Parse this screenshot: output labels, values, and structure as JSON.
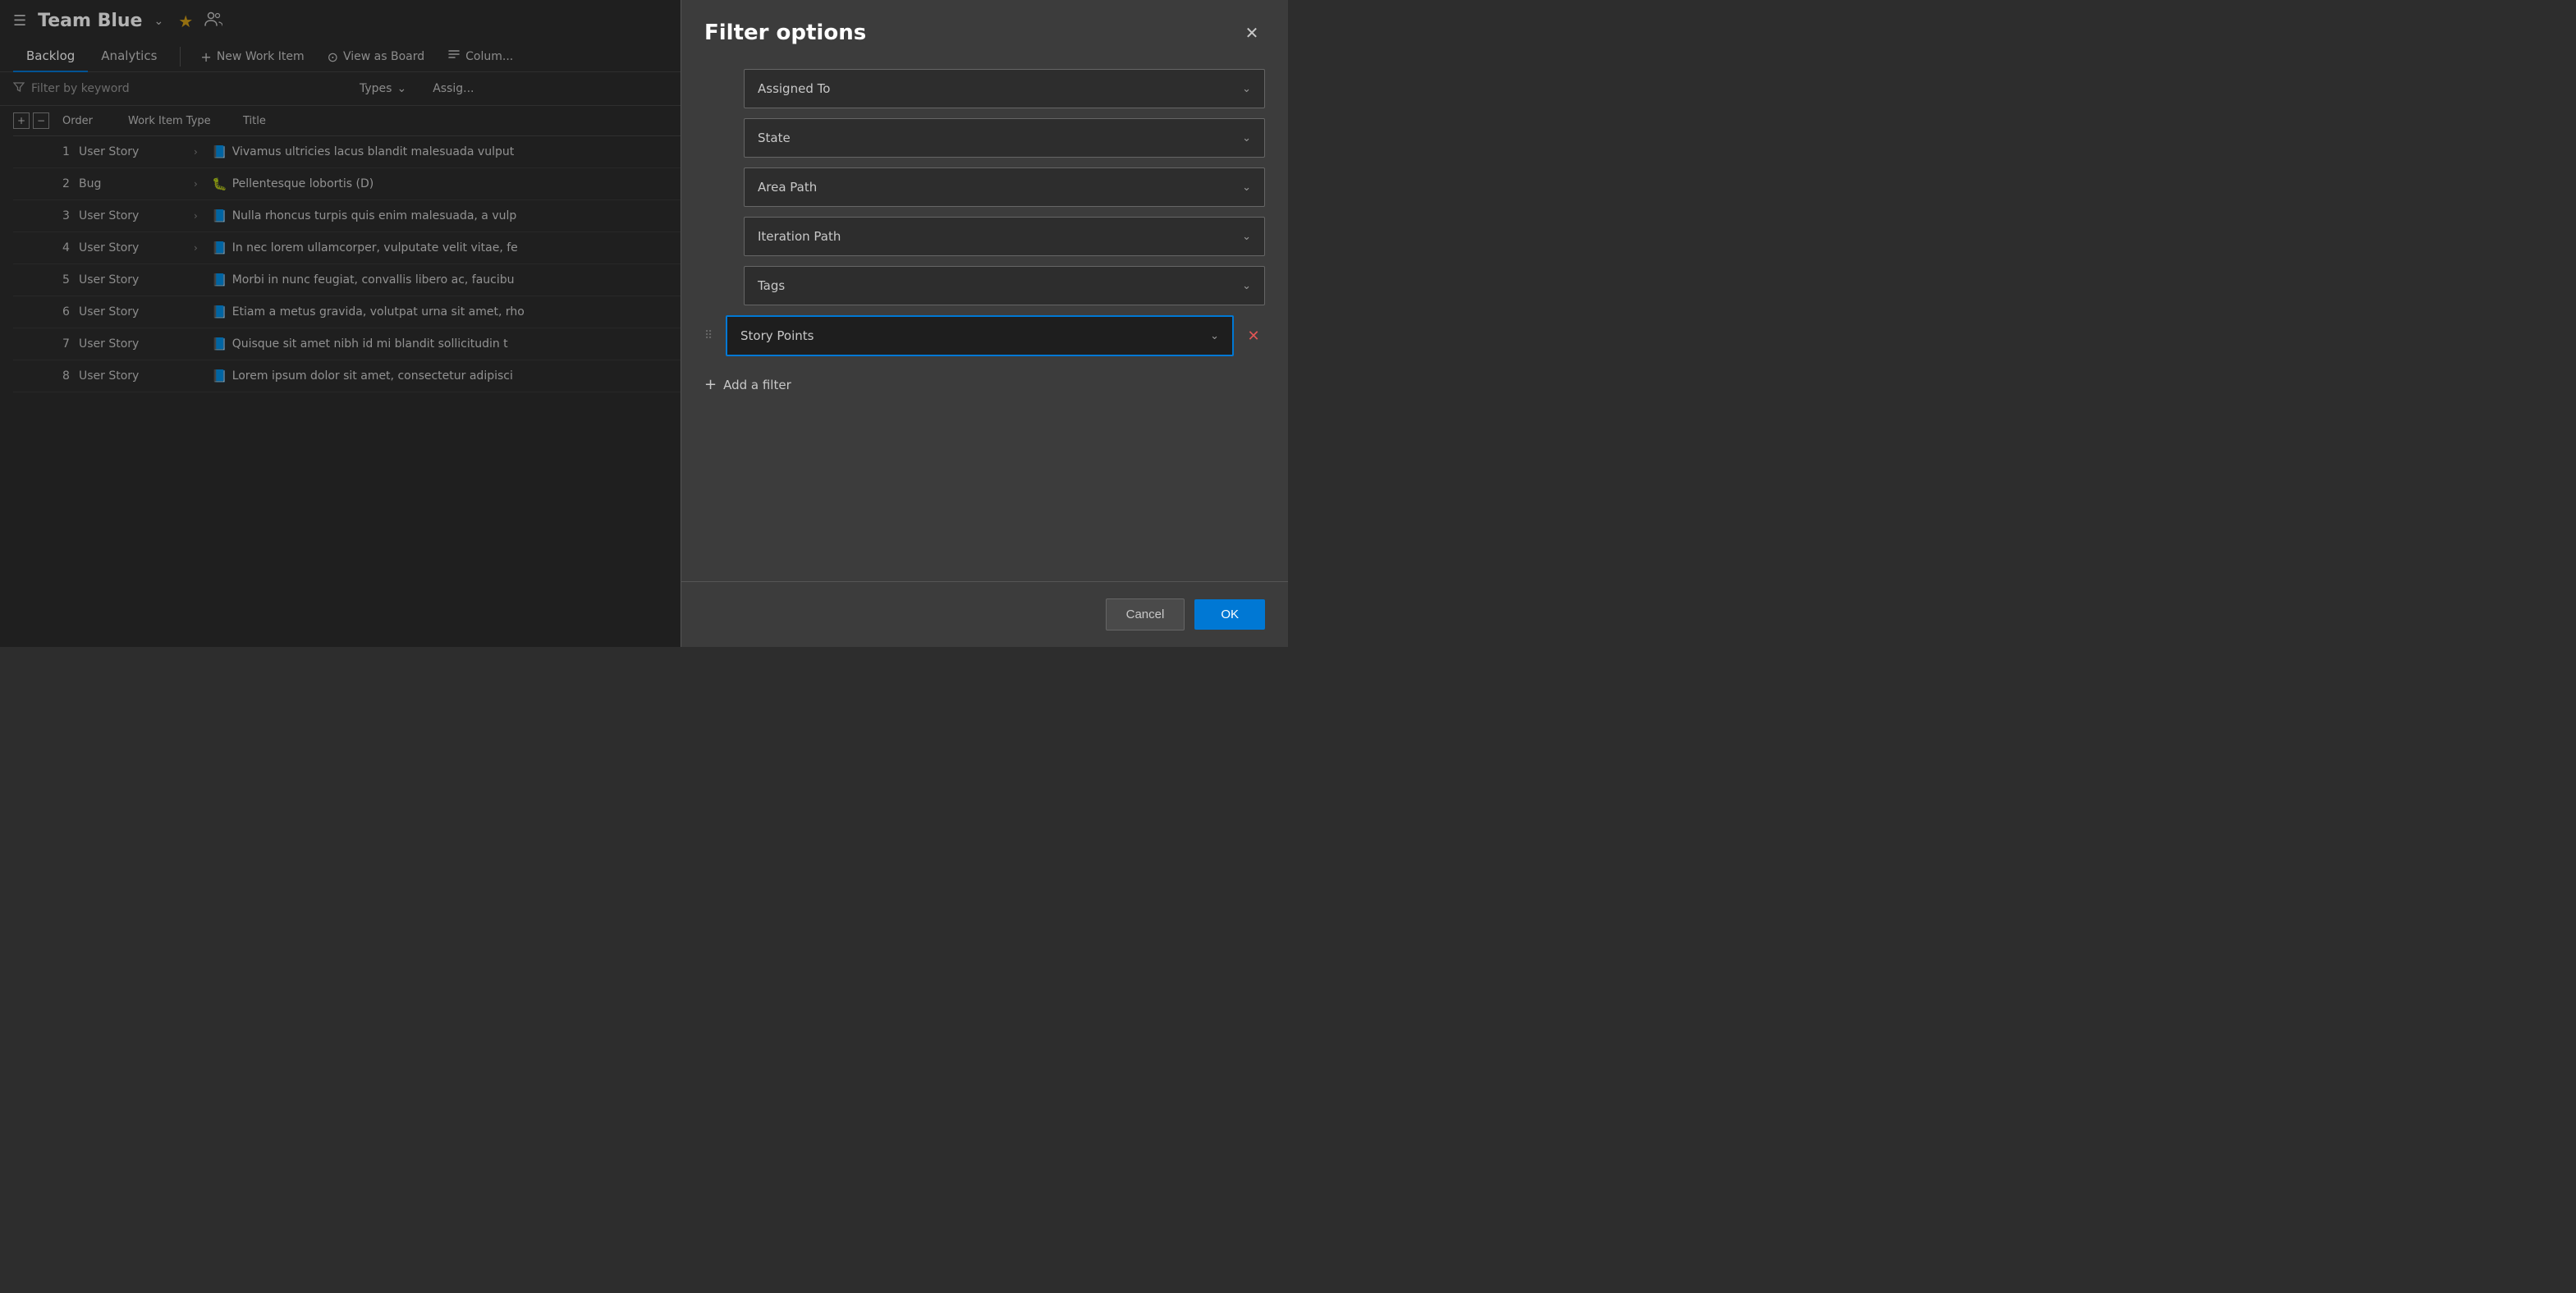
{
  "header": {
    "hamburger": "☰",
    "team_name": "Team Blue",
    "chevron": "⌄",
    "star": "★",
    "team_member_icon": "👥"
  },
  "nav": {
    "tabs": [
      {
        "label": "Backlog",
        "active": true
      },
      {
        "label": "Analytics",
        "active": false
      }
    ],
    "toolbar": [
      {
        "label": "New Work Item",
        "icon": "+"
      },
      {
        "label": "View as Board",
        "icon": "⊙"
      },
      {
        "label": "Colum...",
        "icon": "🔧"
      }
    ]
  },
  "filter_bar": {
    "placeholder": "Filter by keyword",
    "types_label": "Types",
    "assign_label": "Assig..."
  },
  "table": {
    "headers": [
      "Order",
      "Work Item Type",
      "Title"
    ],
    "rows": [
      {
        "order": "1",
        "type": "User Story",
        "icon_type": "story",
        "has_chevron": true,
        "title": "Vivamus ultricies lacus blandit malesuada vulput"
      },
      {
        "order": "2",
        "type": "Bug",
        "icon_type": "bug",
        "has_chevron": true,
        "title": "Pellentesque lobortis (D)"
      },
      {
        "order": "3",
        "type": "User Story",
        "icon_type": "story",
        "has_chevron": true,
        "title": "Nulla rhoncus turpis quis enim malesuada, a vulp"
      },
      {
        "order": "4",
        "type": "User Story",
        "icon_type": "story",
        "has_chevron": true,
        "title": "In nec lorem ullamcorper, vulputate velit vitae, fe"
      },
      {
        "order": "5",
        "type": "User Story",
        "icon_type": "story",
        "has_chevron": false,
        "title": "Morbi in nunc feugiat, convallis libero ac, faucibu"
      },
      {
        "order": "6",
        "type": "User Story",
        "icon_type": "story",
        "has_chevron": false,
        "title": "Etiam a metus gravida, volutpat urna sit amet, rho"
      },
      {
        "order": "7",
        "type": "User Story",
        "icon_type": "story",
        "has_chevron": false,
        "title": "Quisque sit amet nibh id mi blandit sollicitudin t"
      },
      {
        "order": "8",
        "type": "User Story",
        "icon_type": "story",
        "has_chevron": false,
        "title": "Lorem ipsum dolor sit amet, consectetur adipisci"
      }
    ]
  },
  "dialog": {
    "title": "Filter options",
    "close_icon": "✕",
    "filters": [
      {
        "label": "Assigned To",
        "active": false,
        "removable": false
      },
      {
        "label": "State",
        "active": false,
        "removable": false
      },
      {
        "label": "Area Path",
        "active": false,
        "removable": false
      },
      {
        "label": "Iteration Path",
        "active": false,
        "removable": false
      },
      {
        "label": "Tags",
        "active": false,
        "removable": false
      },
      {
        "label": "Story Points",
        "active": true,
        "removable": true
      }
    ],
    "add_filter_label": "Add a filter",
    "cancel_label": "Cancel",
    "ok_label": "OK"
  }
}
